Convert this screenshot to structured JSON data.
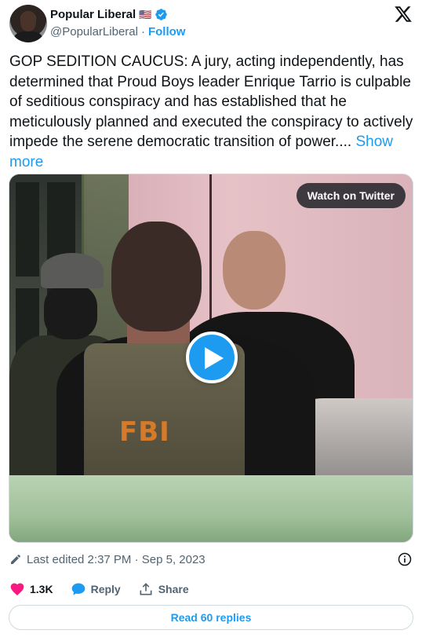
{
  "author": {
    "display_name": "Popular Liberal",
    "flag_emoji": "🇺🇸",
    "handle": "@PopularLiberal",
    "separator": "·",
    "follow_label": "Follow",
    "verified_icon": "verified-badge-icon",
    "verified_color": "#1d9bf0"
  },
  "platform_logo": "x-logo-icon",
  "tweet": {
    "text": "GOP SEDITION CAUCUS: A jury, acting independently, has determined that Proud Boys leader Enrique Tarrio is culpable of seditious conspiracy and has established that he meticulously planned and executed the conspiracy to actively impede the serene democratic transition of power....",
    "show_more_label": "Show more"
  },
  "media": {
    "watch_label": "Watch on Twitter",
    "vest_text": "FBI",
    "play_icon": "play-icon",
    "play_color": "#1d9bf0"
  },
  "meta": {
    "edited_text": "Last edited 2:37 PM · Sep 5, 2023",
    "edit_icon": "pencil-icon",
    "info_icon": "info-icon"
  },
  "actions": {
    "like_count": "1.3K",
    "like_color": "#f91880",
    "reply_label": "Reply",
    "share_label": "Share"
  },
  "footer": {
    "read_replies_label": "Read 60 replies"
  },
  "colors": {
    "accent": "#1d9bf0",
    "text": "#0f1419",
    "secondary": "#536471",
    "border": "#cfd9de"
  }
}
